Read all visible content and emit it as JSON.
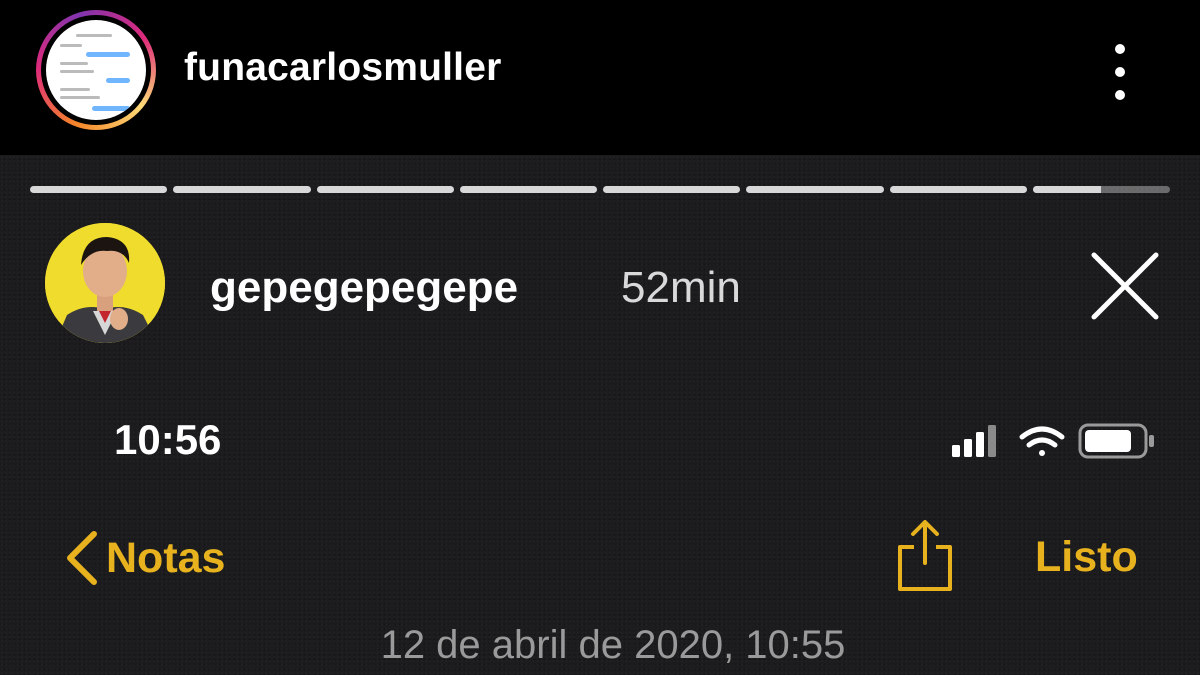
{
  "header": {
    "username": "funacarlosmuller"
  },
  "story": {
    "segments": [
      1,
      1,
      1,
      1,
      1,
      1,
      1,
      0.5
    ],
    "poster_username": "gepegepegepe",
    "posted_ago": "52min"
  },
  "phone": {
    "status_time": "10:56",
    "back_label": "Notas",
    "done_label": "Listo",
    "note_date": "12 de abril de 2020, 10:55"
  },
  "colors": {
    "accent": "#e8b21e",
    "background": "#1c1c1e"
  },
  "icons": {
    "more": "more-vertical-icon",
    "close": "close-icon",
    "back": "chevron-left-icon",
    "share": "share-icon",
    "signal": "cellular-signal-icon",
    "wifi": "wifi-icon",
    "battery": "battery-icon"
  }
}
